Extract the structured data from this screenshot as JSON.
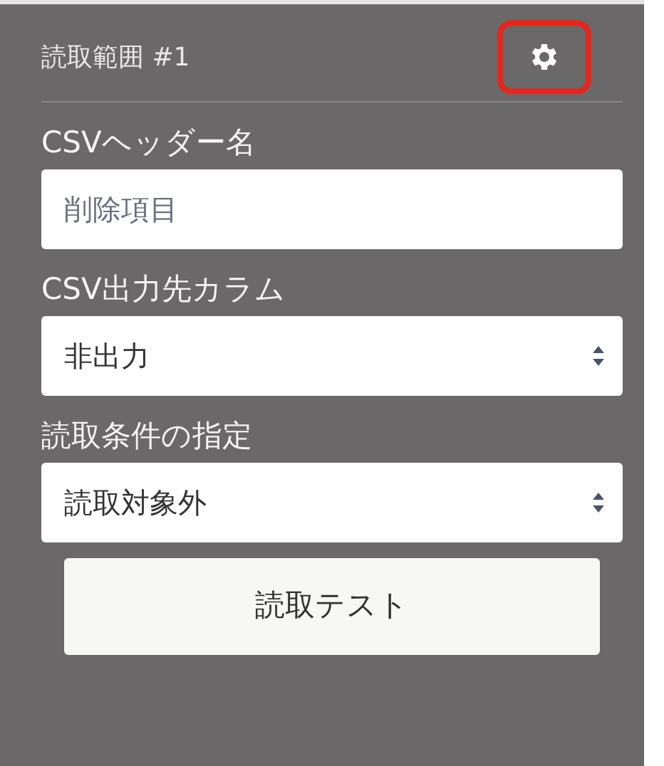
{
  "panel": {
    "title": "読取範囲 #1",
    "settings_highlighted": true
  },
  "fields": [
    {
      "kind": "text",
      "label": "CSVヘッダー名",
      "placeholder": "削除項目"
    },
    {
      "kind": "select",
      "label": "CSV出力先カラム",
      "value": "非出力"
    },
    {
      "kind": "select",
      "label": "読取条件の指定",
      "value": "読取対象外"
    }
  ],
  "button": "読取テスト"
}
